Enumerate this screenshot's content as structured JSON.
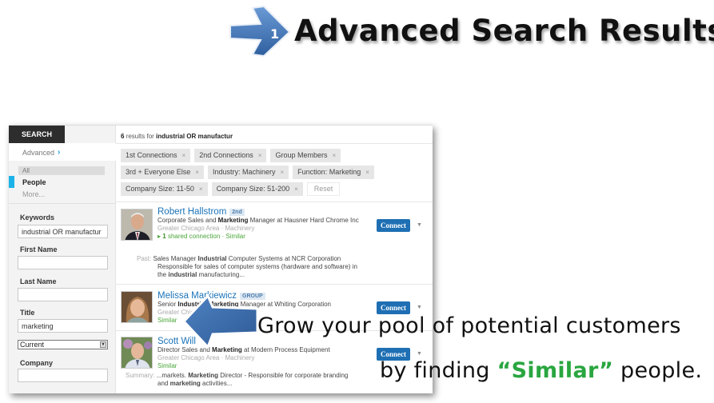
{
  "slide": {
    "step_number": "1",
    "title": "Advanced Search Results",
    "tagline_line1": "Grow your pool of potential customers",
    "tagline_line2_before": "by finding ",
    "tagline_highlight": "“Similar”",
    "tagline_line2_after": " people.",
    "highlight_color": "#2aa640",
    "arrow_color": "#3a6fb0"
  },
  "sidebar": {
    "search_tab": "SEARCH",
    "advanced_label": "Advanced",
    "advanced_icon": "chevron-right-icon",
    "types": {
      "all": "All",
      "people": "People",
      "more": "More..."
    },
    "fields": {
      "keywords_label": "Keywords",
      "keywords_value": "industrial OR manufactur",
      "first_name_label": "First Name",
      "first_name_value": "",
      "last_name_label": "Last Name",
      "last_name_value": "",
      "title_label": "Title",
      "title_value": "marketing",
      "title_scope": "Current",
      "company_label": "Company",
      "company_value": ""
    }
  },
  "results": {
    "count": "6",
    "count_text": "results for",
    "query": "industrial OR manufactur",
    "filters_row1": [
      "1st Connections",
      "2nd Connections",
      "Group Members"
    ],
    "filters_row2": [
      "3rd + Everyone Else",
      "Industry: Machinery",
      "Function: Marketing"
    ],
    "filters_row3": [
      "Company Size: 11-50",
      "Company Size: 51-200"
    ],
    "reset_label": "Reset",
    "remove_icon": "×",
    "connect_label": "Connect",
    "items": [
      {
        "name": "Robert Hallstrom",
        "badge": "2nd",
        "headline_pre": "Corporate Sales and ",
        "headline_bold": "Marketing",
        "headline_post": " Manager at Hausner Hard Chrome Inc",
        "location": "Greater Chicago Area · Machinery",
        "shared_count": "1",
        "shared_text": "shared connection · Similar",
        "extra_label": "Past:",
        "extra_line1_pre": "Sales Manager ",
        "extra_line1_bold": "Industrial",
        "extra_line1_post": " Computer Systems at NCR Corporation",
        "extra_line2": "Responsible for sales of computer systems (hardware and software) in",
        "extra_line3_pre": "the ",
        "extra_line3_bold": "industrial",
        "extra_line3_post": " manufacturing..."
      },
      {
        "name": "Melissa Markiewicz",
        "badge": "GROUP",
        "headline_pre": "Senior ",
        "headline_bold": "Industrial Marketing",
        "headline_post": " Manager at Whiting Corporation",
        "location": "Greater Chicago Area · Machinery",
        "similar": "Similar"
      },
      {
        "name": "Scott Will",
        "badge": "",
        "headline_pre": "Director Sales and ",
        "headline_bold": "Marketing",
        "headline_post": " at Modern Process Equipment",
        "location": "Greater Chicago Area · Machinery",
        "similar": "Similar",
        "extra_label": "Summary:",
        "extra_line1_pre": "...markets. ",
        "extra_line1_bold": "Marketing",
        "extra_line1_post": " Director - Responsible for corporate branding",
        "extra_line2_pre": "and ",
        "extra_line2_bold": "marketing",
        "extra_line2_post": " activities..."
      }
    ]
  }
}
